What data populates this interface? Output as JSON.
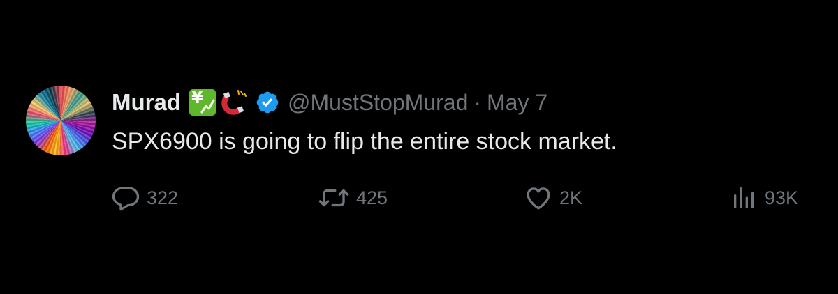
{
  "tweet": {
    "display_name": "Murad",
    "handle": "@MustStopMurad",
    "separator": "·",
    "date": "May 7",
    "text": "SPX6900 is going to flip the entire stock market.",
    "name_emojis": [
      "chart-increasing-with-yen",
      "magnet"
    ],
    "verified": true
  },
  "actions": {
    "replies": "322",
    "reposts": "425",
    "likes": "2K",
    "views": "93K"
  },
  "colors": {
    "background": "#000000",
    "primary_text": "#e7e9ea",
    "secondary_text": "#71767b",
    "verified_badge": "#1d9bf0"
  }
}
